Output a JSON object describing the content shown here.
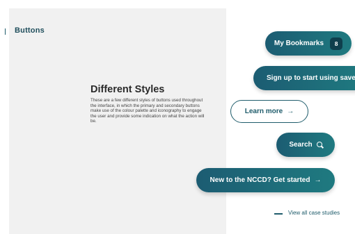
{
  "section": {
    "label": "Buttons"
  },
  "content": {
    "heading": "Different Styles",
    "description": "These are a few different styles of buttons used throughout the interface, in which the primary and secondary buttons make use of the colour palette and iconography to engage the user and provide some indication on what the action will be."
  },
  "buttons": {
    "bookmarks": {
      "label": "My Bookmarks",
      "count": "8"
    },
    "signup": {
      "label": "Sign up to start using save"
    },
    "learn_more": {
      "label": "Learn more",
      "icon": "arrow-right-icon"
    },
    "search": {
      "label": "Search",
      "icon": "search-icon"
    },
    "get_started": {
      "label": "New to the NCCD? Get started",
      "icon": "arrow-right-icon"
    }
  },
  "link": {
    "label": "View all case studies"
  },
  "colors": {
    "primary": "#1c5c72",
    "accent": "#1f7a80",
    "panel": "#f1f1f1"
  }
}
